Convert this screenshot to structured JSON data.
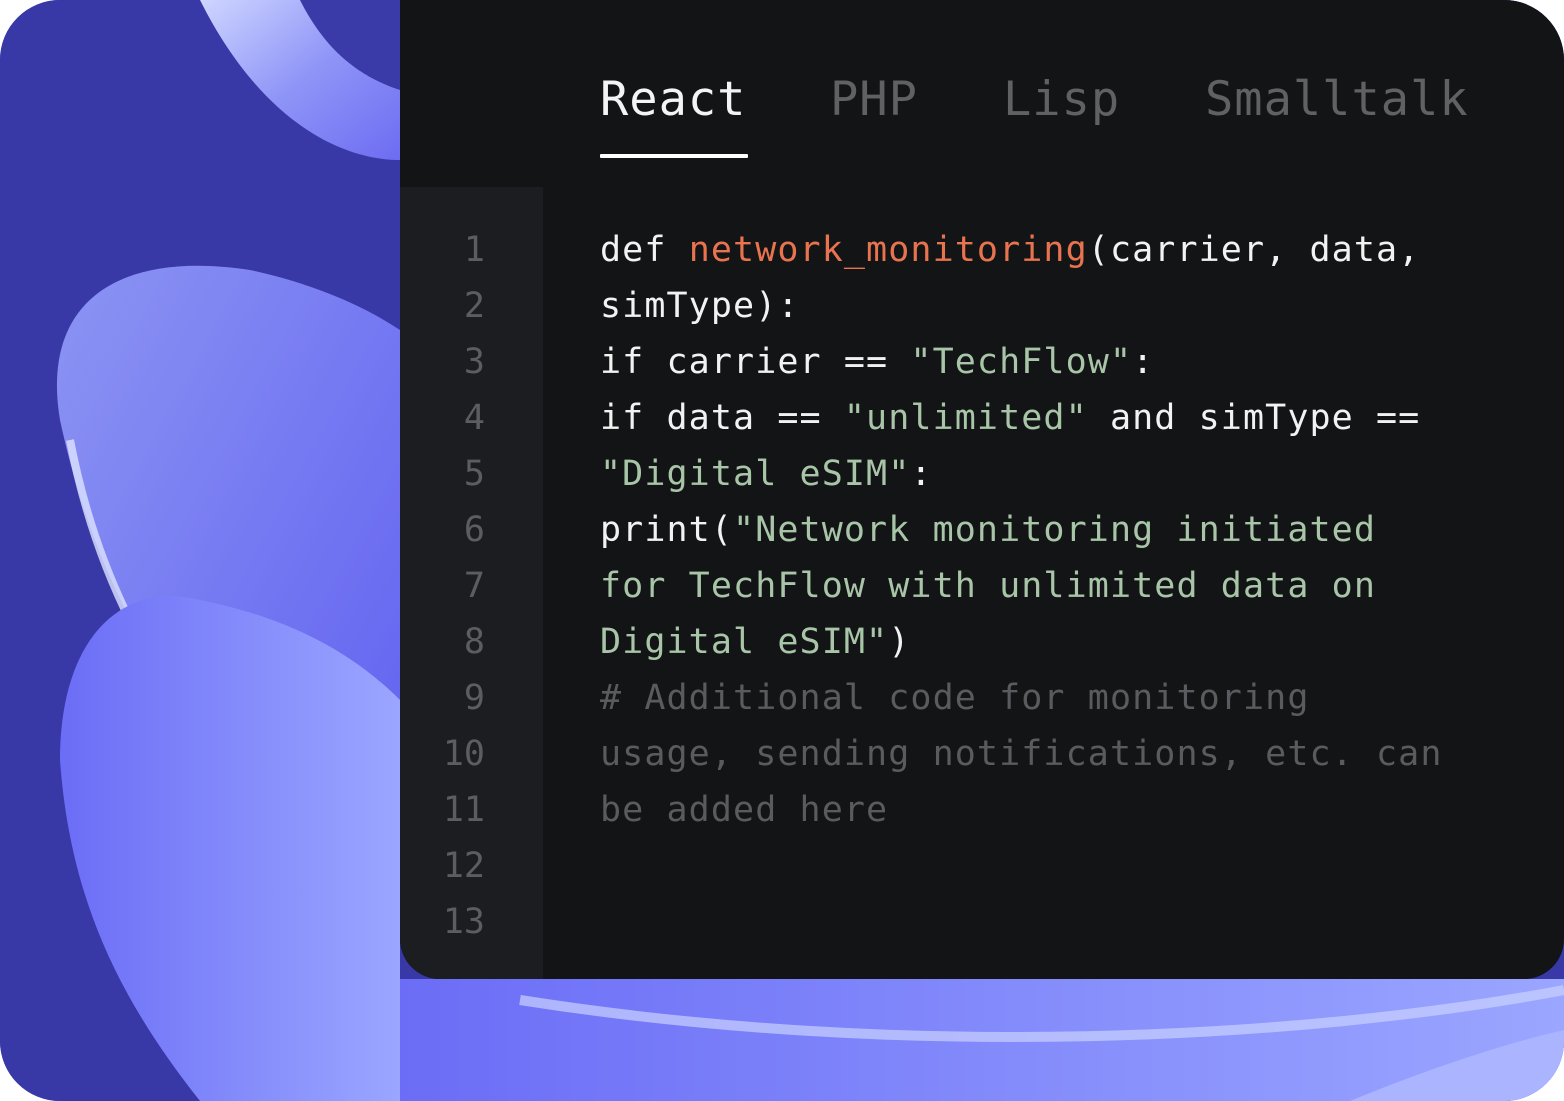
{
  "tabs": [
    {
      "label": "React",
      "active": true
    },
    {
      "label": "PHP",
      "active": false
    },
    {
      "label": "Lisp",
      "active": false
    },
    {
      "label": "Smalltalk",
      "active": false
    }
  ],
  "line_numbers": [
    "1",
    "2",
    "3",
    "4",
    "5",
    "6",
    "7",
    "8",
    "9",
    "10",
    "11",
    "12",
    "13"
  ],
  "code": {
    "l1_kw": "def ",
    "l1_fn": "network_monitoring",
    "l1_rest": "(carrier, data,",
    "l2": "simType):",
    "l3_a": "if carrier == ",
    "l3_str": "\"TechFlow\"",
    "l3_b": ":",
    "l4_a": "if data == ",
    "l4_str": "\"unlimited\"",
    "l4_b": " and simType ==",
    "l5_str": "\"Digital eSIM\"",
    "l5_b": ":",
    "l6_a": "print(",
    "l6_str": "\"Network monitoring initiated",
    "l7_str": "for TechFlow with unlimited data on",
    "l8_str": "Digital eSIM\"",
    "l8_b": ")",
    "l9": "# Additional code for monitoring",
    "l10": "usage, sending notifications, etc. can",
    "l11": "be added here"
  },
  "colors": {
    "background": "#3a3aa8",
    "editor": "#131416",
    "gutter": "#1c1d20",
    "function": "#e8734f",
    "string": "#a8c5a8",
    "comment": "#595b5e",
    "text": "#f2f2f2"
  }
}
